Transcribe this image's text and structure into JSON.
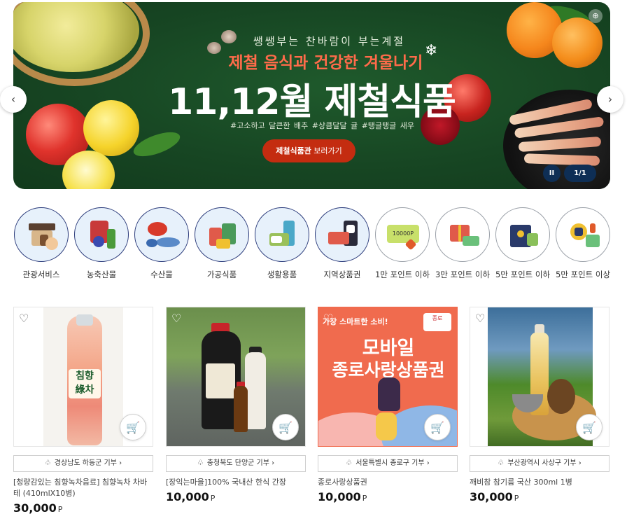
{
  "banner": {
    "subtitle": "쌩쌩부는 찬바람이 부는계절",
    "tagline": "제철 음식과 건강한 겨울나기",
    "title": "11,12월 제철식품",
    "hashtags": "#고소하고 달큰한 배추  #상큼달달 귤  #탱글탱글 새우",
    "button_strong": "제철식품관",
    "button_rest": " 보러가기",
    "pause_label": "II",
    "pager": "1/1",
    "prev_arrow": "‹",
    "next_arrow": "›",
    "snowflake": "❄"
  },
  "categories": [
    {
      "label": "관광서비스",
      "icon": "hanok-tourism-icon"
    },
    {
      "label": "농축산물",
      "icon": "meat-vegetable-icon"
    },
    {
      "label": "수산물",
      "icon": "seafood-icon"
    },
    {
      "label": "가공식품",
      "icon": "processed-food-icon"
    },
    {
      "label": "생활용품",
      "icon": "household-goods-icon"
    },
    {
      "label": "지역상품권",
      "icon": "local-voucher-icon"
    },
    {
      "label": "1만 포인트 이하",
      "icon": "10000-point-card-icon",
      "badge": "10000P"
    },
    {
      "label": "3만 포인트 이하",
      "icon": "gift-box-icon"
    },
    {
      "label": "5만 포인트 이하",
      "icon": "gift-bag-icon"
    },
    {
      "label": "5만 포인트 이상",
      "icon": "premium-gift-icon"
    }
  ],
  "products": [
    {
      "region": "경상남도 하동군 기부",
      "name": "[청량감있는 침향녹차음료] 침향녹차 차바테 (410mlX10병)",
      "price": "30,000",
      "unit": "P",
      "label_text": "침향\n綠차"
    },
    {
      "region": "충청북도 단양군 기부",
      "name": "[장익는마을]100% 국내산 한식 간장",
      "price": "10,000",
      "unit": "P"
    },
    {
      "region": "서울특별시 종로구 기부",
      "name": "종로사랑상품권",
      "price": "10,000",
      "unit": "P",
      "image_top": "가장 스마트한 소비!",
      "image_line1": "모바일",
      "image_line2": "종로사랑상품권",
      "image_logo": "종로"
    },
    {
      "region": "부산광역시 사상구 기부",
      "name": "깨비참 참기름 국산 300ml 1병",
      "price": "30,000",
      "unit": "P"
    }
  ],
  "icons": {
    "heart": "♡",
    "cart": "🛒",
    "donate": "♧",
    "chevron": "›"
  }
}
